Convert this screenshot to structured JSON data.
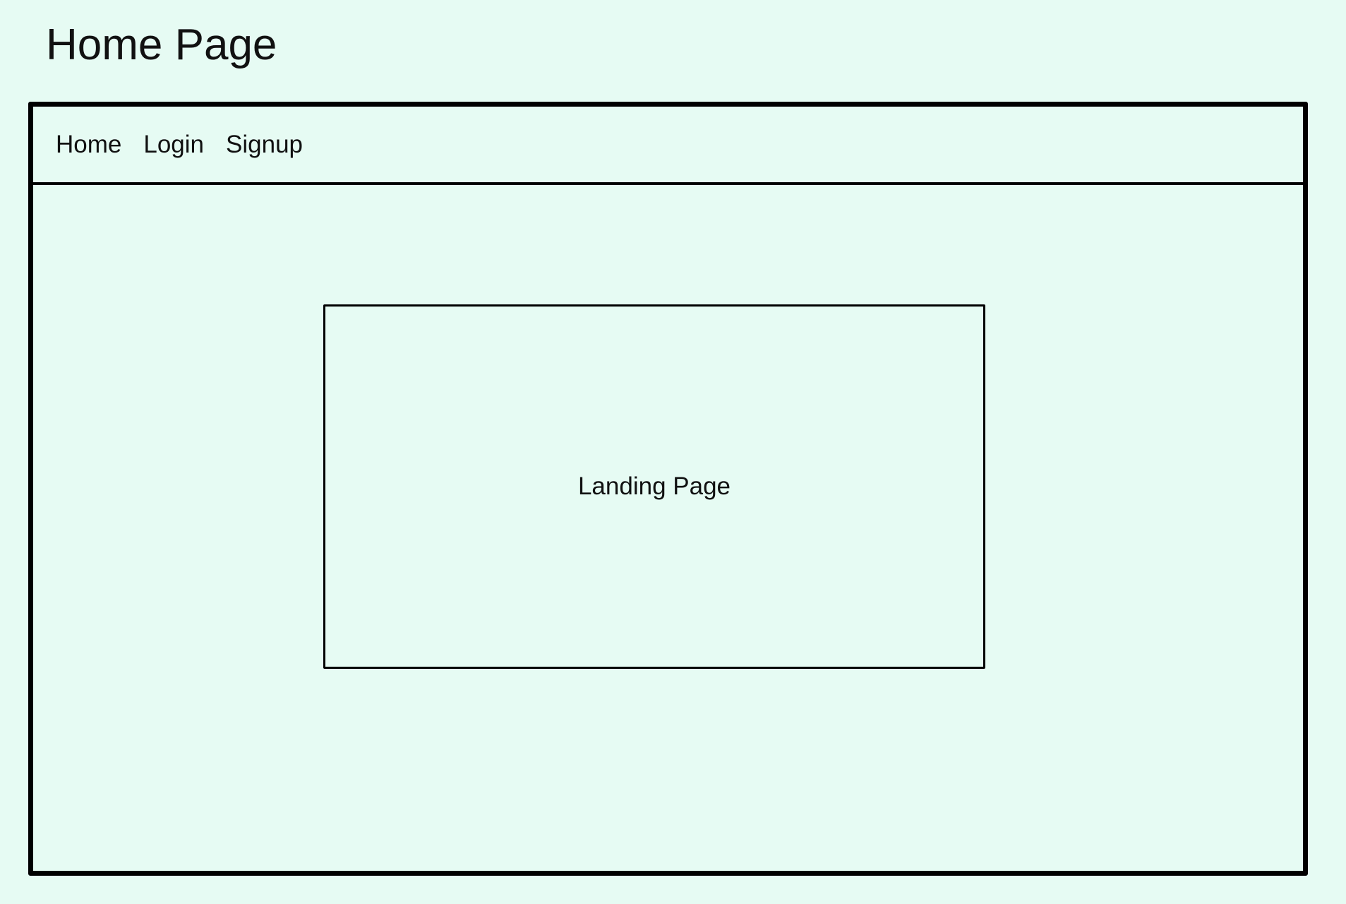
{
  "page": {
    "title": "Home Page"
  },
  "navbar": {
    "items": [
      {
        "label": "Home"
      },
      {
        "label": "Login"
      },
      {
        "label": "Signup"
      }
    ]
  },
  "main": {
    "landing_label": "Landing Page"
  },
  "colors": {
    "background": "#e6fbf3",
    "stroke": "#000000",
    "text": "#111111"
  }
}
